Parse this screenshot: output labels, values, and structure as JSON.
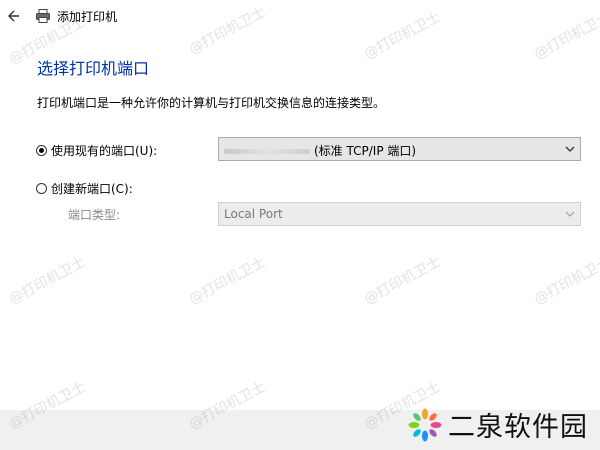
{
  "window": {
    "title": "添加打印机"
  },
  "heading": "选择打印机端口",
  "description": "打印机端口是一种允许你的计算机与打印机交换信息的连接类型。",
  "options": {
    "existing_label": "使用现有的端口(U):",
    "existing_checked": true,
    "existing_value": "(标准 TCP/IP 端口)",
    "new_label": "创建新端口(C):",
    "new_checked": false,
    "port_type_label": "端口类型:",
    "port_type_value": "Local Port"
  },
  "watermark_text": "@打印机卫士",
  "brand": {
    "text": "二泉软件园"
  }
}
